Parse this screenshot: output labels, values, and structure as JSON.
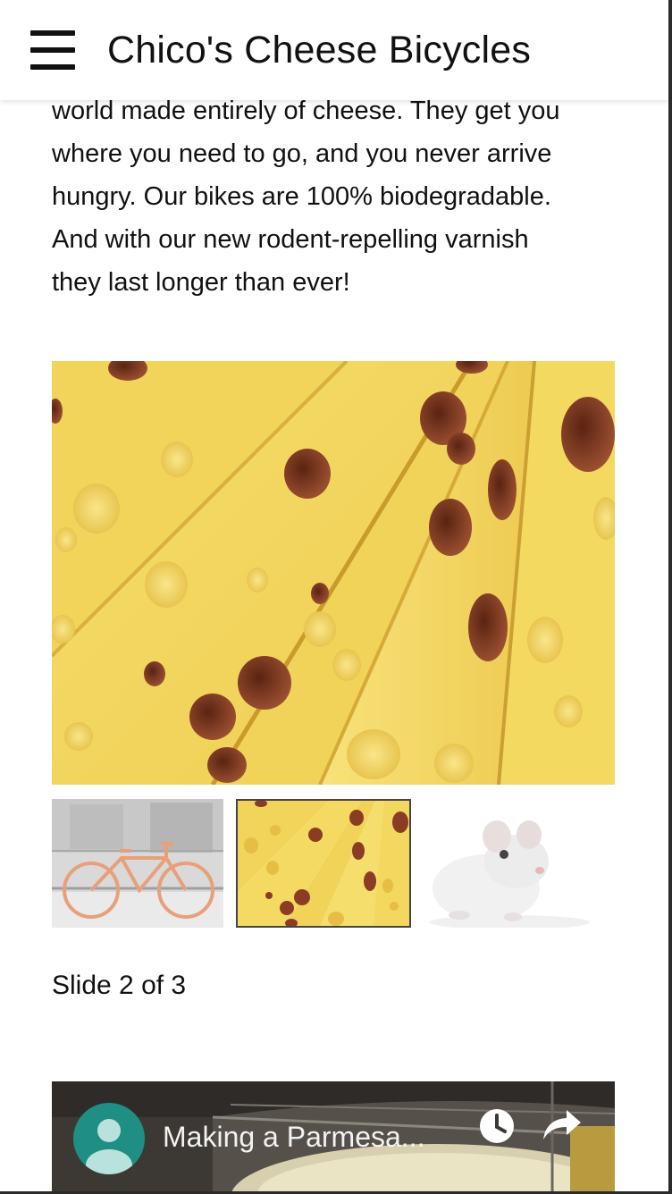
{
  "header": {
    "title": "Chico's Cheese Bicycles",
    "menu_icon": "hamburger-menu-icon"
  },
  "intro": {
    "lines": [
      "world made entirely of cheese. They get you",
      "where you need to go, and you never arrive",
      "hungry. Our bikes are 100% biodegradable.",
      "And with our new rodent-repelling varnish",
      "they last longer than ever!"
    ]
  },
  "slideshow": {
    "counter": "Slide 2 of 3",
    "current": 2,
    "total": 3,
    "thumbnails": [
      "orange bicycle",
      "swiss cheese",
      "white mouse"
    ]
  },
  "video": {
    "title": "Making a Parmesa...",
    "icons": [
      "account-icon",
      "clock-icon",
      "share-icon"
    ]
  },
  "colors": {
    "cheese": "#f3d760",
    "cheese_hole": "#8a3d24",
    "avatar": "#1f8f83",
    "bike": "#e8a07a"
  }
}
